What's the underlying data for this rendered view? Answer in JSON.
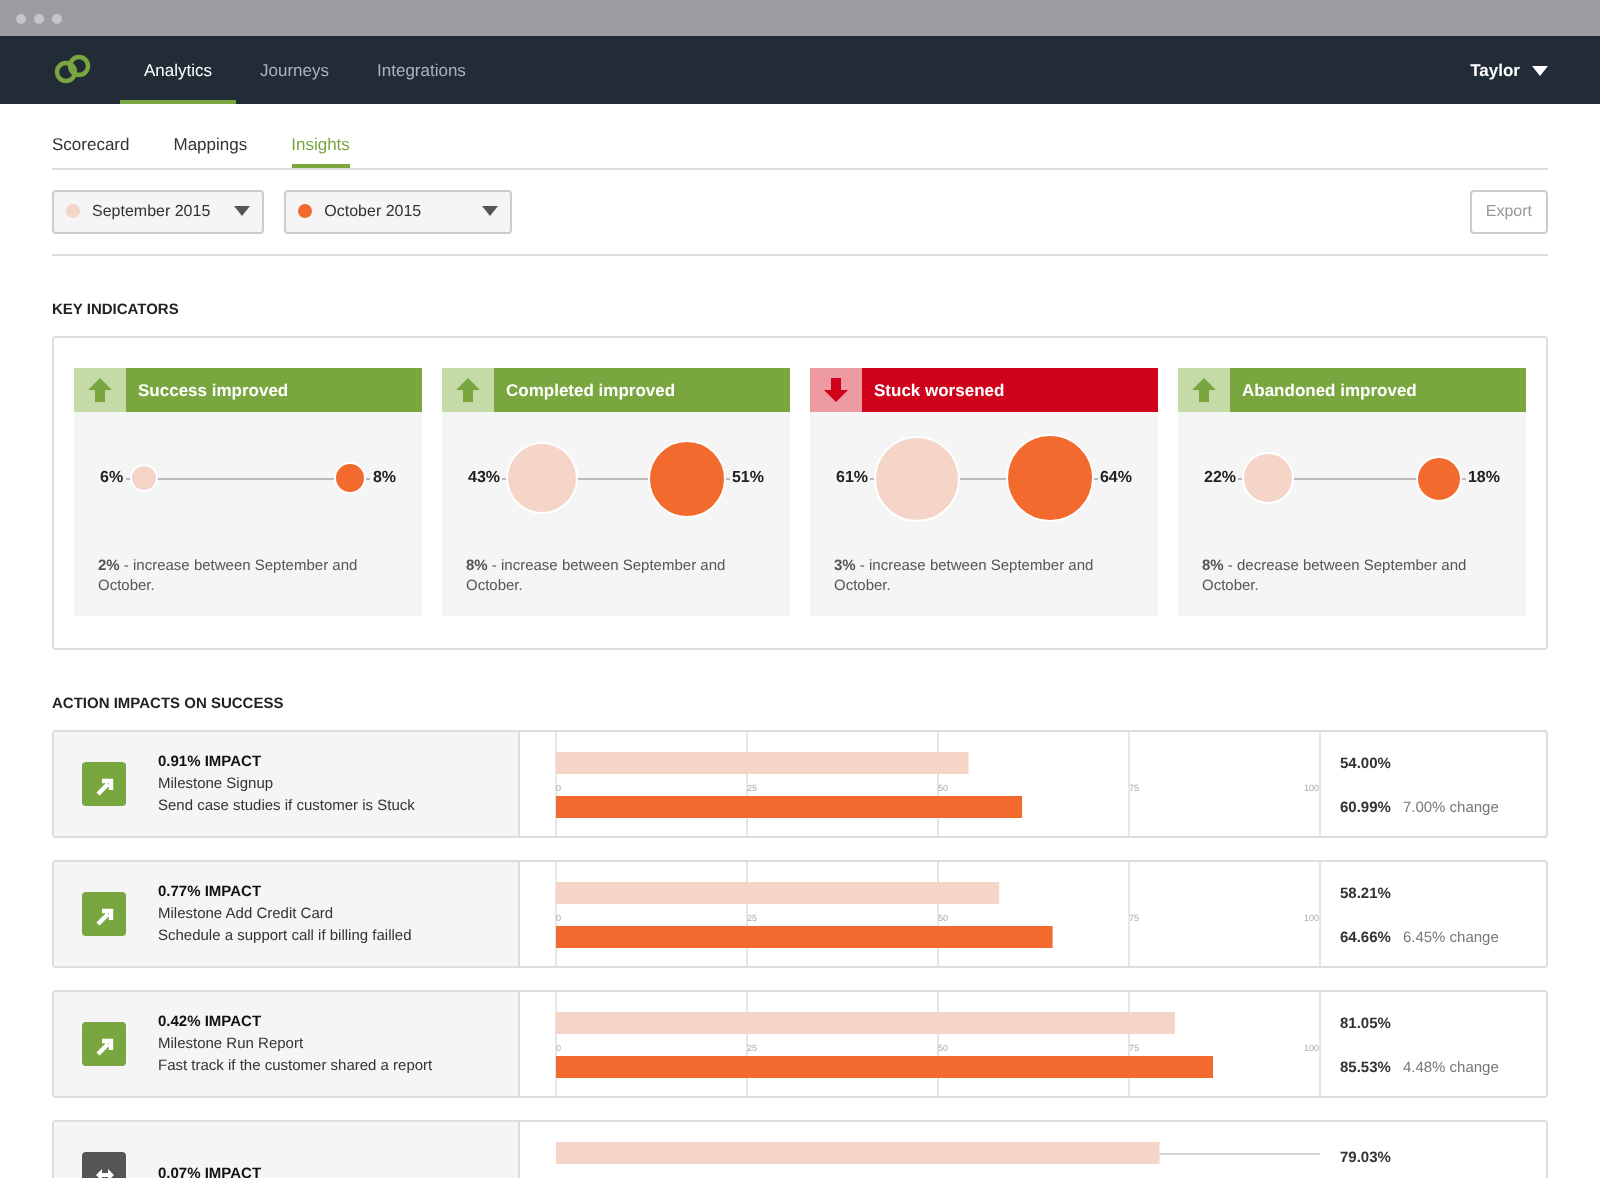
{
  "nav": {
    "tabs": [
      {
        "label": "Analytics",
        "selected": true
      },
      {
        "label": "Journeys",
        "selected": false
      },
      {
        "label": "Integrations",
        "selected": false
      }
    ],
    "user": "Taylor"
  },
  "subtabs": [
    {
      "label": "Scorecard",
      "selected": false
    },
    {
      "label": "Mappings",
      "selected": false
    },
    {
      "label": "Insights",
      "selected": true
    }
  ],
  "filters": [
    {
      "label": "September 2015",
      "color": "#f5d5c8"
    },
    {
      "label": "October 2015",
      "color": "#f26a2e"
    }
  ],
  "export_button": "Export",
  "key_indicators": {
    "title": "KEY INDICATORS",
    "cards": [
      {
        "kind": "improved",
        "title": "Success improved",
        "before": "6%",
        "after": "8%",
        "note": "**2%** - increase between September and October."
      },
      {
        "kind": "improved",
        "title": "Completed improved",
        "before": "43%",
        "after": "51%",
        "note": "**8%** - increase between September and October."
      },
      {
        "kind": "worsened",
        "title": "Stuck worsened",
        "before": "61%",
        "after": "64%",
        "note": "**3%** - increase between September and October."
      },
      {
        "kind": "improved",
        "title": "Abandoned improved",
        "before": "22%",
        "after": "18%",
        "note": "**8%** - decrease between September and October."
      }
    ]
  },
  "action_impacts": {
    "title": "ACTION IMPACTS ON SUCCESS",
    "rows": [
      {
        "kind": "up",
        "impact": "0.91% IMPACT",
        "milestone": "Milestone Signup",
        "action": "Send case studies if customer is Stuck",
        "before": "54.00%",
        "after": "60.99%",
        "change": "7.00% change",
        "chart_data": {
          "type": "bar",
          "orientation": "horizontal",
          "xlim": [
            0,
            100
          ],
          "xticks": [
            0,
            25,
            50,
            75,
            100
          ],
          "grid": true,
          "series": [
            {
              "color": "#f5d5c8",
              "values": [
                54
              ]
            },
            {
              "color": "#f26a2e",
              "values": [
                61
              ]
            }
          ]
        }
      },
      {
        "kind": "up",
        "impact": "0.77% IMPACT",
        "milestone": "Milestone Add Credit Card",
        "action": "Schedule a support call if billing failled",
        "before": "58.21%",
        "after": "64.66%",
        "change": "6.45% change",
        "chart_data": {
          "type": "bar",
          "orientation": "horizontal",
          "xlim": [
            0,
            100
          ],
          "xticks": [
            0,
            25,
            50,
            75,
            100
          ],
          "grid": true,
          "series": [
            {
              "color": "#f5d5c8",
              "values": [
                58
              ]
            },
            {
              "color": "#f26a2e",
              "values": [
                65
              ]
            }
          ]
        }
      },
      {
        "kind": "up",
        "impact": "0.42% IMPACT",
        "milestone": "Milestone Run Report",
        "action": "Fast track if the customer shared a report",
        "before": "81.05%",
        "after": "85.53%",
        "change": "4.48% change",
        "chart_data": {
          "type": "bar",
          "orientation": "horizontal",
          "xlim": [
            0,
            100
          ],
          "xticks": [
            0,
            25,
            50,
            75,
            100
          ],
          "grid": true,
          "series": [
            {
              "color": "#f5d5c8",
              "values": [
                81
              ]
            },
            {
              "color": "#f26a2e",
              "values": [
                86
              ]
            }
          ]
        }
      },
      {
        "kind": "neutral",
        "impact": "0.07% IMPACT",
        "before": "79.03%",
        "level": 0.79
      }
    ]
  }
}
